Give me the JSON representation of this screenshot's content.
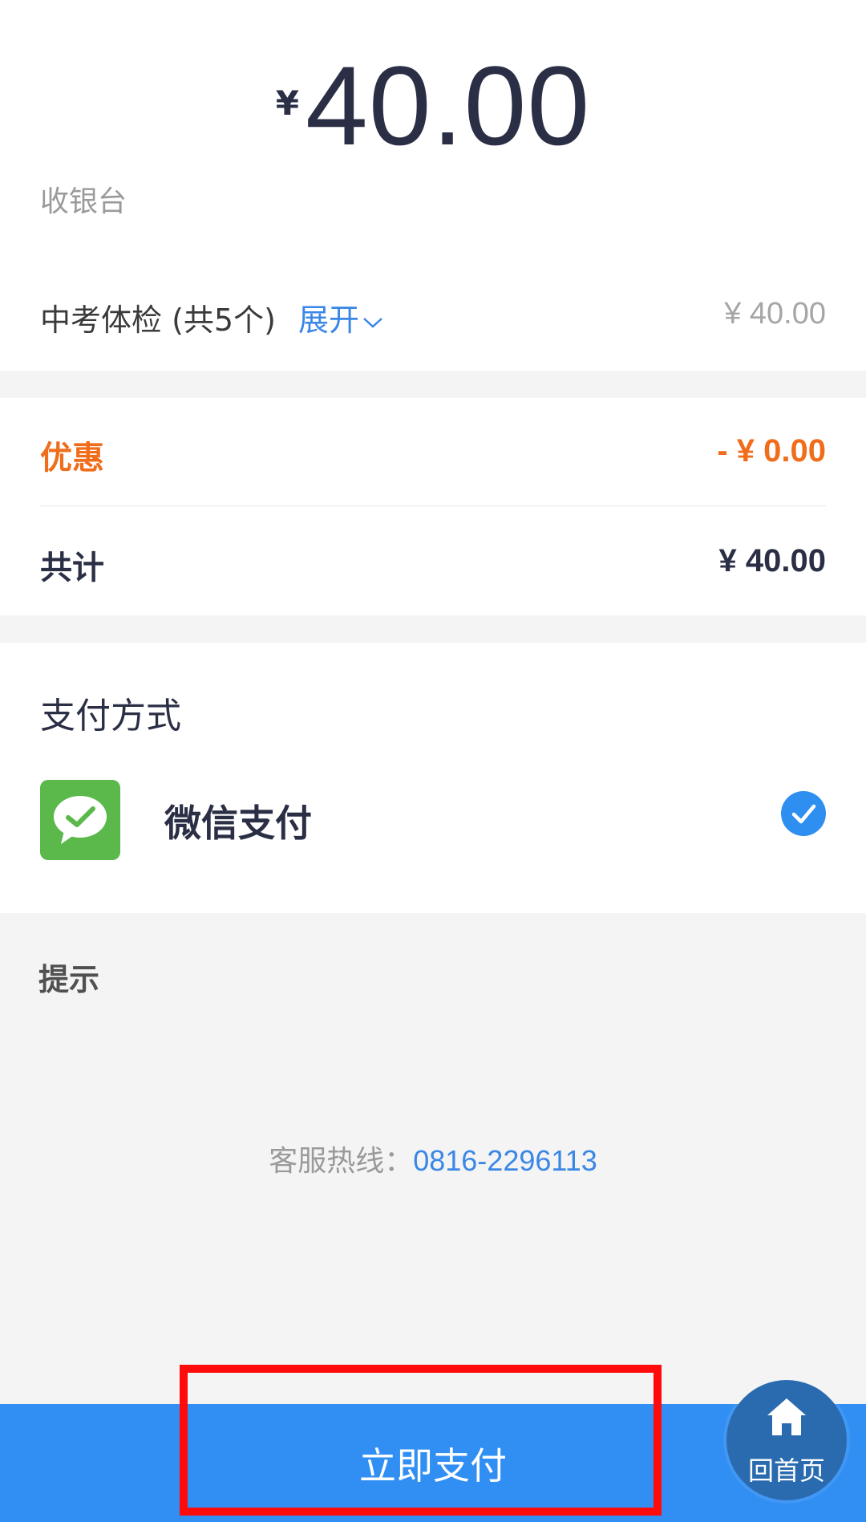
{
  "header": {
    "currency": "¥",
    "amount": "40.00",
    "subtitle": "收银台"
  },
  "item": {
    "title": "中考体检 (共5个)",
    "expand_label": "展开",
    "amount": "¥ 40.00"
  },
  "summary": {
    "discount_label": "优惠",
    "discount_value": "- ¥ 0.00",
    "total_label": "共计",
    "total_value": "¥ 40.00"
  },
  "payment": {
    "section_title": "支付方式",
    "method_label": "微信支付",
    "method_icon": "wechat-pay-icon",
    "selected": true
  },
  "tips": {
    "title": "提示",
    "hotline_label": "客服热线：",
    "hotline_number": "0816-2296113"
  },
  "footer": {
    "pay_button": "立即支付",
    "home_label": "回首页",
    "home_icon": "home-icon"
  },
  "colors": {
    "primary_blue": "#318ff3",
    "discount_orange": "#f06d1b",
    "wechat_green": "#5ab94a",
    "highlight_red": "#ff0b0b"
  }
}
